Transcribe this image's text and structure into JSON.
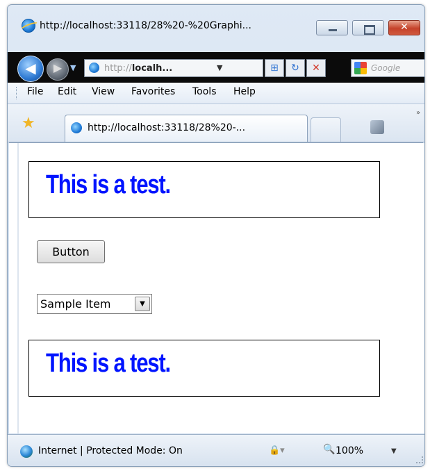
{
  "window": {
    "title": "http://localhost:33118/28%20-%20Graphi...",
    "minimize_label": "",
    "maximize_label": "",
    "close_label": "✕"
  },
  "nav": {
    "back_glyph": "◀",
    "forward_glyph": "▶",
    "address_prefix": "http://",
    "address_host": "localh...",
    "dropdown_glyph": "▼",
    "search_placeholder": "Google",
    "compat_glyph": "⊞",
    "refresh_glyph": "↻",
    "stop_glyph": "✕"
  },
  "menu": {
    "items": [
      "File",
      "Edit",
      "View",
      "Favorites",
      "Tools",
      "Help"
    ]
  },
  "tabs": {
    "active_label": "http://localhost:33118/28%20-...",
    "favorites_glyph": "★",
    "chevron": "»"
  },
  "content": {
    "heading_top": "This is a test.",
    "button_label": "Button",
    "select_value": "Sample Item",
    "select_arrow": "▼",
    "heading_bottom": "This is a test."
  },
  "status": {
    "text": "Internet | Protected Mode: On",
    "security_glyph": "🔒▾",
    "zoom_glyph": "🔍",
    "zoom_level": "100%",
    "zoom_dropdown": "▼"
  }
}
